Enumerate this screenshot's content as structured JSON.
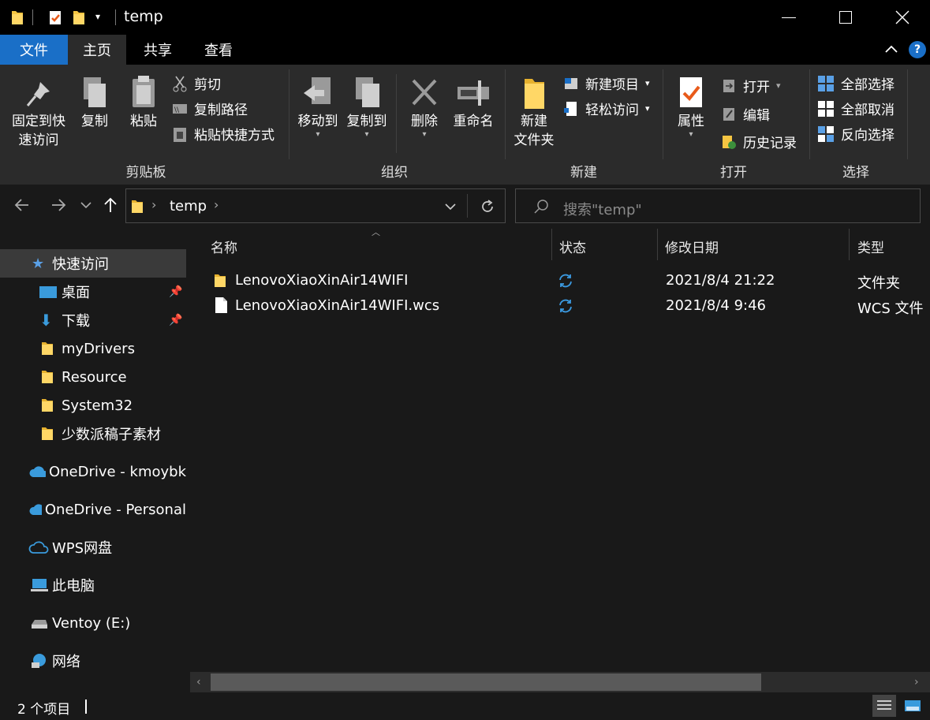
{
  "window": {
    "title": "temp"
  },
  "ribbon_tabs": [
    {
      "label": "文件"
    },
    {
      "label": "主页"
    },
    {
      "label": "共享"
    },
    {
      "label": "查看"
    }
  ],
  "ribbon": {
    "clipboard": {
      "pin_label_1": "固定到快",
      "pin_label_2": "速访问",
      "copy": "复制",
      "paste": "粘贴",
      "cut": "剪切",
      "copy_path": "复制路径",
      "paste_shortcut": "粘贴快捷方式",
      "group": "剪贴板"
    },
    "organize": {
      "move_to": "移动到",
      "copy_to": "复制到",
      "delete": "删除",
      "rename": "重命名",
      "group": "组织"
    },
    "new": {
      "new_folder_1": "新建",
      "new_folder_2": "文件夹",
      "new_item": "新建项目",
      "easy_access": "轻松访问",
      "group": "新建"
    },
    "open": {
      "properties": "属性",
      "open": "打开",
      "edit": "编辑",
      "history": "历史记录",
      "group": "打开"
    },
    "select": {
      "select_all": "全部选择",
      "select_none": "全部取消",
      "invert": "反向选择",
      "group": "选择"
    }
  },
  "address": {
    "crumb": "temp",
    "search_placeholder": "搜索\"temp\""
  },
  "nav": {
    "quick_access": "快速访问",
    "items": [
      {
        "label": "桌面"
      },
      {
        "label": "下载"
      },
      {
        "label": "myDrivers"
      },
      {
        "label": "Resource"
      },
      {
        "label": "System32"
      },
      {
        "label": "少数派稿子素材"
      }
    ],
    "onedrive1": "OneDrive - kmoybk",
    "onedrive2": "OneDrive - Personal",
    "wps": "WPS网盘",
    "thispc": "此电脑",
    "ventoy": "Ventoy (E:)",
    "network": "网络"
  },
  "columns": {
    "name": "名称",
    "status": "状态",
    "date": "修改日期",
    "type": "类型"
  },
  "files": [
    {
      "name": "LenovoXiaoXinAir14WIFI",
      "date": "2021/8/4 21:22",
      "type": "文件夹"
    },
    {
      "name": "LenovoXiaoXinAir14WIFI.wcs",
      "date": "2021/8/4 9:46",
      "type": "WCS 文件"
    }
  ],
  "status": {
    "count": "2 个项目"
  },
  "colors": {
    "accent": "#1a6fc7",
    "folder": "#f5c542",
    "sync": "#3b9ae1"
  }
}
